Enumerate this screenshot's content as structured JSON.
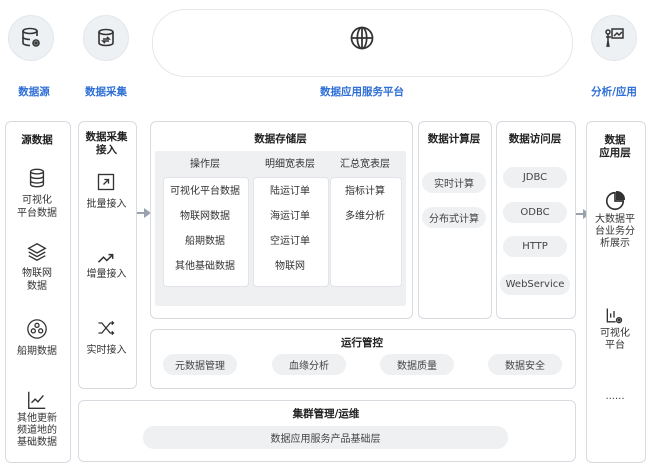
{
  "top": {
    "source_label": "数据源",
    "collect_label": "数据采集",
    "platform_label": "数据应用服务平台",
    "analysis_label": "分析/应用"
  },
  "col_source": {
    "title": "源数据",
    "items": [
      "可视化\n平台数据",
      "物联网\n数据",
      "船期数据",
      "其他更新\n频道地的\n基础数据"
    ]
  },
  "col_collect": {
    "title": "数据采集\n接入",
    "items": [
      "批量接入",
      "增量接入",
      "实时接入"
    ]
  },
  "storage": {
    "title": "数据存储层",
    "ops": {
      "title": "操作层",
      "items": [
        "可视化平台数据",
        "物联网数据",
        "船期数据",
        "其他基础数据"
      ]
    },
    "detail": {
      "title": "明细宽表层",
      "items": [
        "陆运订单",
        "海运订单",
        "空运订单",
        "物联网"
      ]
    },
    "summary": {
      "title": "汇总宽表层",
      "items": [
        "指标计算",
        "多维分析"
      ]
    }
  },
  "compute": {
    "title": "数据计算层",
    "items": [
      "实时计算",
      "分布式计算"
    ]
  },
  "access": {
    "title": "数据访问层",
    "items": [
      "JDBC",
      "ODBC",
      "HTTP",
      "WebService"
    ]
  },
  "app_layer": {
    "title": "数据\n应用层",
    "items": [
      "大数据平\n台业务分\n析展示",
      "可视化\n平台"
    ],
    "ellipsis": "......"
  },
  "ops_control": {
    "title": "运行管控",
    "items": [
      "元数据管理",
      "血缘分析",
      "数据质量",
      "数据安全"
    ]
  },
  "cluster": {
    "title": "集群管理/运维",
    "bar": "数据应用服务产品基础层"
  },
  "colors": {
    "accent": "#2f6fd6",
    "border": "#d7dbe0",
    "pill": "#eef0f2"
  }
}
